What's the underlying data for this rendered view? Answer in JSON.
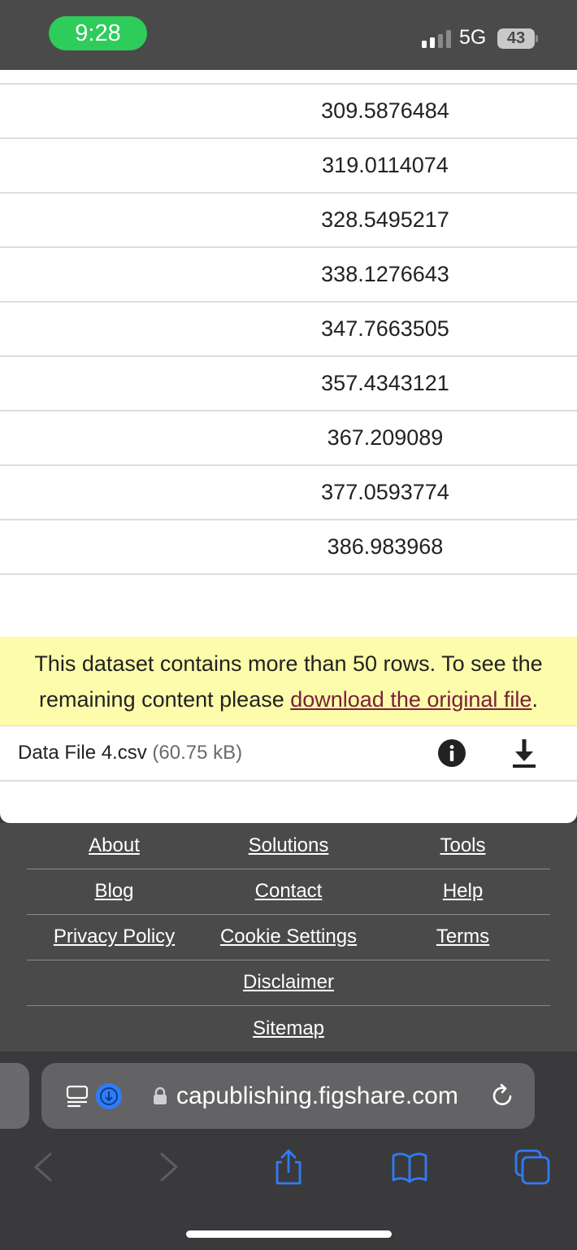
{
  "status_bar": {
    "time": "9:28",
    "network": "5G",
    "battery": "43",
    "colors": {
      "time_pill": "#2ecc5a"
    }
  },
  "table": {
    "rows": [
      "309.5876484",
      "319.0114074",
      "328.5495217",
      "338.1276643",
      "347.7663505",
      "357.4343121",
      "367.209089",
      "377.0593774",
      "386.983968"
    ]
  },
  "notice": {
    "text_before": "This dataset contains more than 50 rows. To see the remaining content please ",
    "link_text": "download the original file",
    "text_after": "."
  },
  "file": {
    "name": "Data File 4.csv",
    "size": "(60.75 kB)",
    "icons": [
      "info-icon",
      "download-icon"
    ]
  },
  "footer": {
    "rows": [
      [
        "About",
        "Solutions",
        "Tools"
      ],
      [
        "Blog",
        "Contact",
        "Help"
      ],
      [
        "Privacy Policy",
        "Cookie Settings",
        "Terms"
      ],
      [
        "Disclaimer"
      ],
      [
        "Sitemap"
      ]
    ]
  },
  "browser": {
    "url": "capublishing.figshare.com",
    "toolbar_icons": [
      "back-icon",
      "forward-icon",
      "share-icon",
      "bookmarks-icon",
      "tabs-icon"
    ],
    "accent": "#2f7cf6"
  }
}
